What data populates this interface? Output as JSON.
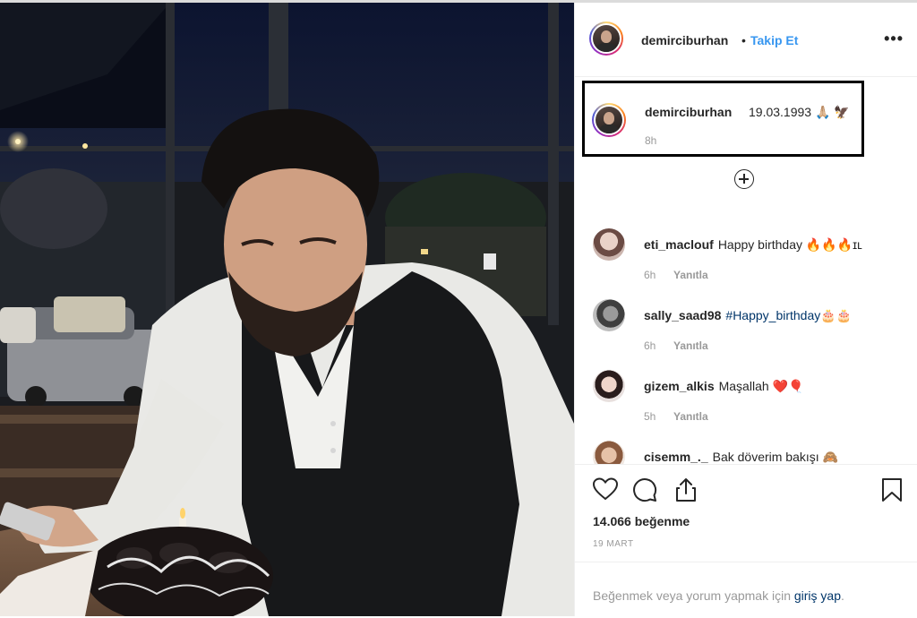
{
  "post": {
    "username": "demirciburhan",
    "dot": "•",
    "follow_label": "Takip Et",
    "more_label": "•••",
    "more_icon": "more-horizontal-icon"
  },
  "caption": {
    "username": "demirciburhan",
    "text": "19.03.1993 🙏🏼 🦅",
    "time": "8h"
  },
  "load_more_icon": "plus-circle-icon",
  "comments": [
    {
      "user": "eti_maclouf",
      "text": "Happy birthday 🔥🔥🔥ɪʟ",
      "time": "6h",
      "reply": "Yanıtla"
    },
    {
      "user": "sally_saad98",
      "tag": "#Happy_birthday",
      "text": "🎂🎂",
      "time": "6h",
      "reply": "Yanıtla"
    },
    {
      "user": "gizem_alkis",
      "text": "Maşallah ❤️🎈",
      "time": "5h",
      "reply": "Yanıtla"
    },
    {
      "user": "cisemm_._",
      "text": "Bak döverim bakışı 🙈",
      "time": "",
      "reply": ""
    }
  ],
  "actions": {
    "icons": [
      "heart-icon",
      "comment-icon",
      "share-icon",
      "bookmark-icon"
    ],
    "likes": "14.066 beğenme",
    "date": "19 MART"
  },
  "login_prompt": {
    "prefix": "Beğenmek veya yorum yapmak için ",
    "link": "giriş yap",
    "suffix": "."
  },
  "colors": {
    "link_blue": "#3897f0",
    "muted": "#999999",
    "text": "#262626",
    "hashtag": "#003569"
  }
}
